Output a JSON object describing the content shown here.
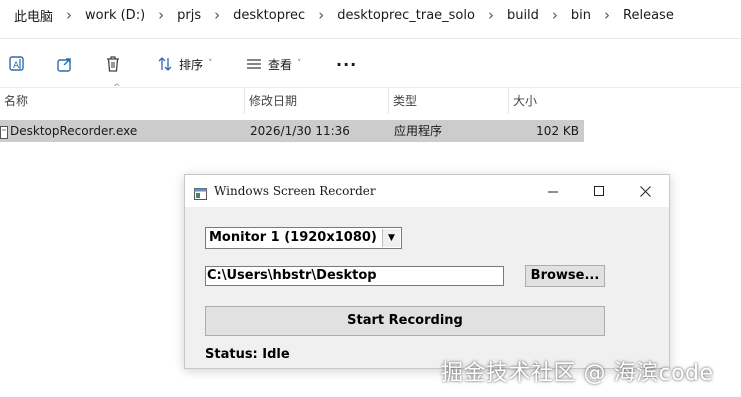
{
  "breadcrumb": [
    "此电脑",
    "work (D:)",
    "prjs",
    "desktoprec",
    "desktoprec_trae_solo",
    "build",
    "bin",
    "Release"
  ],
  "toolbar": {
    "icons": [
      "rename-icon",
      "share-icon",
      "delete-icon",
      "sort-icon",
      "view-icon",
      "more-icon"
    ],
    "sort_label": "排序",
    "view_label": "查看",
    "more_label": "···"
  },
  "columns": {
    "name": "名称",
    "modified": "修改日期",
    "type": "类型",
    "size": "大小"
  },
  "file": {
    "name": "DesktopRecorder.exe",
    "modified": "2026/1/30 11:36",
    "type": "应用程序",
    "size": "102 KB"
  },
  "window": {
    "title": "Windows Screen Recorder",
    "monitor_select": "Monitor 1 (1920x1080)",
    "path_value": "C:\\Users\\hbstr\\Desktop",
    "browse_label": "Browse...",
    "start_label": "Start Recording",
    "status_text": "Status: Idle"
  },
  "watermark": "掘金技术社区 @ 海滨code",
  "colors": {
    "selected_row": "#cccccc",
    "window_bg": "#f0f0f0",
    "button_bg": "#e1e1e1"
  }
}
